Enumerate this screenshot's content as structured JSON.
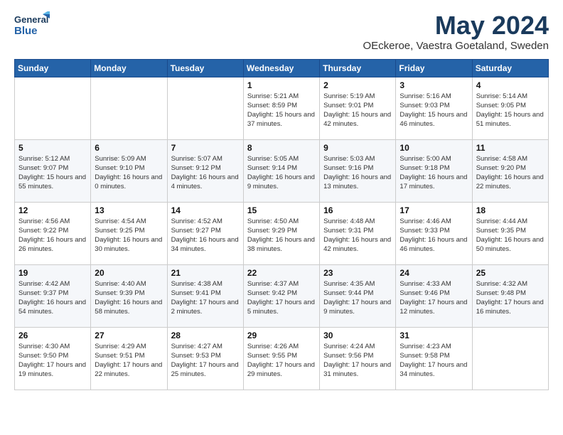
{
  "header": {
    "logo_line1": "General",
    "logo_line2": "Blue",
    "title": "May 2024",
    "location": "OEckeroe, Vaestra Goetaland, Sweden"
  },
  "weekdays": [
    "Sunday",
    "Monday",
    "Tuesday",
    "Wednesday",
    "Thursday",
    "Friday",
    "Saturday"
  ],
  "weeks": [
    [
      {
        "day": "",
        "detail": ""
      },
      {
        "day": "",
        "detail": ""
      },
      {
        "day": "",
        "detail": ""
      },
      {
        "day": "1",
        "detail": "Sunrise: 5:21 AM\nSunset: 8:59 PM\nDaylight: 15 hours\nand 37 minutes."
      },
      {
        "day": "2",
        "detail": "Sunrise: 5:19 AM\nSunset: 9:01 PM\nDaylight: 15 hours\nand 42 minutes."
      },
      {
        "day": "3",
        "detail": "Sunrise: 5:16 AM\nSunset: 9:03 PM\nDaylight: 15 hours\nand 46 minutes."
      },
      {
        "day": "4",
        "detail": "Sunrise: 5:14 AM\nSunset: 9:05 PM\nDaylight: 15 hours\nand 51 minutes."
      }
    ],
    [
      {
        "day": "5",
        "detail": "Sunrise: 5:12 AM\nSunset: 9:07 PM\nDaylight: 15 hours\nand 55 minutes."
      },
      {
        "day": "6",
        "detail": "Sunrise: 5:09 AM\nSunset: 9:10 PM\nDaylight: 16 hours\nand 0 minutes."
      },
      {
        "day": "7",
        "detail": "Sunrise: 5:07 AM\nSunset: 9:12 PM\nDaylight: 16 hours\nand 4 minutes."
      },
      {
        "day": "8",
        "detail": "Sunrise: 5:05 AM\nSunset: 9:14 PM\nDaylight: 16 hours\nand 9 minutes."
      },
      {
        "day": "9",
        "detail": "Sunrise: 5:03 AM\nSunset: 9:16 PM\nDaylight: 16 hours\nand 13 minutes."
      },
      {
        "day": "10",
        "detail": "Sunrise: 5:00 AM\nSunset: 9:18 PM\nDaylight: 16 hours\nand 17 minutes."
      },
      {
        "day": "11",
        "detail": "Sunrise: 4:58 AM\nSunset: 9:20 PM\nDaylight: 16 hours\nand 22 minutes."
      }
    ],
    [
      {
        "day": "12",
        "detail": "Sunrise: 4:56 AM\nSunset: 9:22 PM\nDaylight: 16 hours\nand 26 minutes."
      },
      {
        "day": "13",
        "detail": "Sunrise: 4:54 AM\nSunset: 9:25 PM\nDaylight: 16 hours\nand 30 minutes."
      },
      {
        "day": "14",
        "detail": "Sunrise: 4:52 AM\nSunset: 9:27 PM\nDaylight: 16 hours\nand 34 minutes."
      },
      {
        "day": "15",
        "detail": "Sunrise: 4:50 AM\nSunset: 9:29 PM\nDaylight: 16 hours\nand 38 minutes."
      },
      {
        "day": "16",
        "detail": "Sunrise: 4:48 AM\nSunset: 9:31 PM\nDaylight: 16 hours\nand 42 minutes."
      },
      {
        "day": "17",
        "detail": "Sunrise: 4:46 AM\nSunset: 9:33 PM\nDaylight: 16 hours\nand 46 minutes."
      },
      {
        "day": "18",
        "detail": "Sunrise: 4:44 AM\nSunset: 9:35 PM\nDaylight: 16 hours\nand 50 minutes."
      }
    ],
    [
      {
        "day": "19",
        "detail": "Sunrise: 4:42 AM\nSunset: 9:37 PM\nDaylight: 16 hours\nand 54 minutes."
      },
      {
        "day": "20",
        "detail": "Sunrise: 4:40 AM\nSunset: 9:39 PM\nDaylight: 16 hours\nand 58 minutes."
      },
      {
        "day": "21",
        "detail": "Sunrise: 4:38 AM\nSunset: 9:41 PM\nDaylight: 17 hours\nand 2 minutes."
      },
      {
        "day": "22",
        "detail": "Sunrise: 4:37 AM\nSunset: 9:42 PM\nDaylight: 17 hours\nand 5 minutes."
      },
      {
        "day": "23",
        "detail": "Sunrise: 4:35 AM\nSunset: 9:44 PM\nDaylight: 17 hours\nand 9 minutes."
      },
      {
        "day": "24",
        "detail": "Sunrise: 4:33 AM\nSunset: 9:46 PM\nDaylight: 17 hours\nand 12 minutes."
      },
      {
        "day": "25",
        "detail": "Sunrise: 4:32 AM\nSunset: 9:48 PM\nDaylight: 17 hours\nand 16 minutes."
      }
    ],
    [
      {
        "day": "26",
        "detail": "Sunrise: 4:30 AM\nSunset: 9:50 PM\nDaylight: 17 hours\nand 19 minutes."
      },
      {
        "day": "27",
        "detail": "Sunrise: 4:29 AM\nSunset: 9:51 PM\nDaylight: 17 hours\nand 22 minutes."
      },
      {
        "day": "28",
        "detail": "Sunrise: 4:27 AM\nSunset: 9:53 PM\nDaylight: 17 hours\nand 25 minutes."
      },
      {
        "day": "29",
        "detail": "Sunrise: 4:26 AM\nSunset: 9:55 PM\nDaylight: 17 hours\nand 29 minutes."
      },
      {
        "day": "30",
        "detail": "Sunrise: 4:24 AM\nSunset: 9:56 PM\nDaylight: 17 hours\nand 31 minutes."
      },
      {
        "day": "31",
        "detail": "Sunrise: 4:23 AM\nSunset: 9:58 PM\nDaylight: 17 hours\nand 34 minutes."
      },
      {
        "day": "",
        "detail": ""
      }
    ]
  ]
}
